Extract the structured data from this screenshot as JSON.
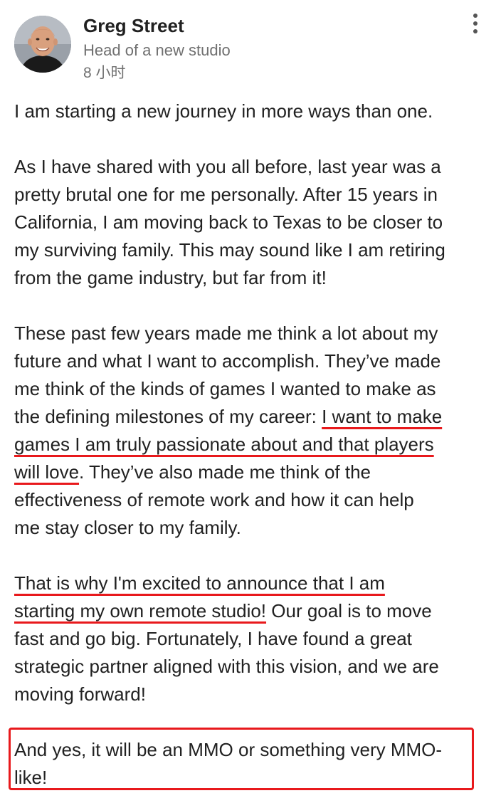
{
  "author": {
    "name": "Greg Street",
    "headline": "Head of a new studio",
    "timestamp": "8 小时"
  },
  "post": {
    "p1": [
      "I am starting a new journey in more ways than one."
    ],
    "p2": [
      "As I have shared with you all before, last year was a",
      "pretty brutal one for me personally. After 15 years in",
      "California, I am moving back to Texas to be closer to",
      "my surviving family. This may sound like I am retiring",
      "from the game industry, but far from it!"
    ],
    "p3": {
      "l1": "These past few years made me think a lot about my",
      "l2": "future and what I want to accomplish. They’ve made",
      "l3": "me think of the kinds of games I wanted to make as",
      "l4a": "the defining milestones of my career: ",
      "l4b": "I want to make",
      "l5": "games I am truly passionate about and that players",
      "l6a": "will love",
      "l6b": ". They’ve also made me think of the",
      "l7": "effectiveness of remote work and how it can help",
      "l8": "me stay closer to my family."
    },
    "p4": {
      "l1": "That is why I'm excited to announce that I am",
      "l2a": "starting my own remote studio!",
      "l2b": " Our goal is to move",
      "l3": "fast and go big. Fortunately, I have found a great",
      "l4": "strategic partner aligned with this vision, and we are",
      "l5": "moving forward!"
    },
    "p5": [
      "And yes, it will be an MMO or something very MMO-",
      "like!"
    ]
  },
  "colors": {
    "annotation_red": "#e8191c",
    "secondary_text": "#707070"
  },
  "icons": {
    "menu": "more-vertical-icon"
  }
}
